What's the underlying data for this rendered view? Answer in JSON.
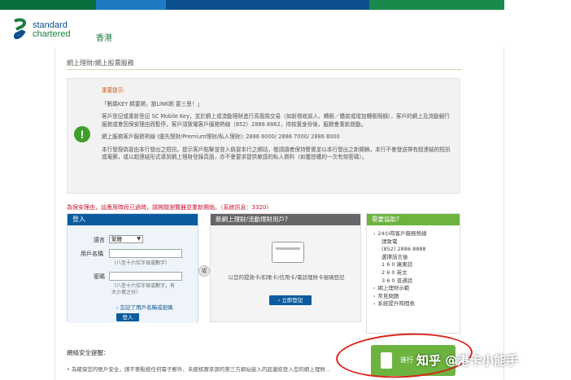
{
  "header": {
    "logo_line1": "standard",
    "logo_line2": "chartered",
    "region": "香港"
  },
  "colors": {
    "bank_green": "#1a7d3f",
    "bank_blue": "#0b4f8c",
    "notice_orange": "#c85a18",
    "warning_red": "#c8102e",
    "help_green": "#6cb33f"
  },
  "section_title": "網上理財/網上股票服務",
  "notice": {
    "icon": "exclamation-icon",
    "title": "重要提示:",
    "p1": "「數碼KEY 精要啲，撳LINK啲 要三思！」",
    "p2": "客戶登記或重新登記 SC Mobile Key，並於網上或流動理財進行高風險交易（如新增收款人、轉賬／繳款或增加轉賬限額），客戶的網上及流動銀行服務或會因保安理由而暫停，客戶須致電客戶服務熱線（852）2886 8862，待核實身份後，服務會重新啟動。",
    "p3": "網上服務客戶服務熱線 (優先理財/Premium理財/私人理財): 2886 6000/ 2886 7000/ 2886 8000",
    "p4": "本行發現偽冒由本行發出之短訊，提示客戶點擊並登入偽冒本行之網站，敬請讀者保持警覺並以本行發出之新聞稿，本行不會發送帶有超連結的短訊或電郵，或以超連結形式導到網上理財登錄頁面，亦不會要求提供敏感的私人資料（如獲授權的一次有效密碼）。"
  },
  "warning": "為保安理由，這應用時段已過時，請開閱瀏覽器並重新開始。（系統訊息：3320）",
  "login": {
    "title": "登入",
    "language_label": "語言",
    "language_value": "繁體",
    "username_label": "用戶名稱",
    "username_hint": "（八至十六位字母或數字）",
    "password_label": "密碼",
    "password_hint_1": "（八至十六位字母或數字，有",
    "password_hint_2": "大小寫之分）",
    "forgot_link": "忘記了用戶名稱或密碼",
    "submit": "登入"
  },
  "or_label": "或",
  "register": {
    "title": "新網上理財/流動理財用戶?",
    "text": "以您的提款卡/扣賬卡/信用卡/電話理財卡號碼登記",
    "button": "立即登記"
  },
  "help": {
    "title": "需要協助?",
    "hotline_title": "24小時客戶服務熱線",
    "lines": [
      "請致電",
      "(852) 2886 8888",
      "選擇語言後",
      "1 6 0 廣東話",
      "2 6 0 英文",
      "3 6 0 普通話"
    ],
    "links": [
      "網上理財示範",
      "常見問題",
      "系統提升時間表"
    ]
  },
  "security": {
    "title": "網絡安全提醒：",
    "text": "• 為確保您的賬戶安全，請不要點按任何電子郵件、未經核實來源的第三方網站嵌入的超連結登入您的網上理財..."
  },
  "start_button": "進行",
  "watermark": "知乎 @港卡小能手"
}
